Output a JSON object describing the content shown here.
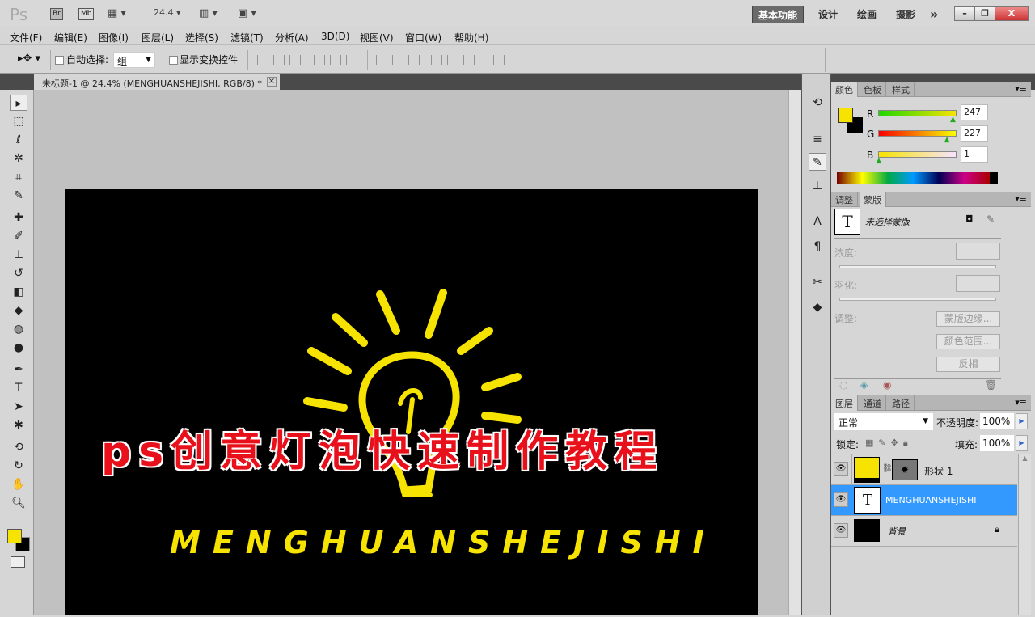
{
  "titlebar": {
    "logo": "Ps",
    "br": "Br",
    "mb": "Mb",
    "zoom": "24.4",
    "workspaces": [
      "基本功能",
      "设计",
      "绘画",
      "摄影"
    ],
    "more": "»",
    "min": "–",
    "restore": "❐",
    "close": "X"
  },
  "menu": [
    "文件(F)",
    "编辑(E)",
    "图像(I)",
    "图层(L)",
    "选择(S)",
    "滤镜(T)",
    "分析(A)",
    "3D(D)",
    "视图(V)",
    "窗口(W)",
    "帮助(H)"
  ],
  "options": {
    "auto_select_label": "自动选择:",
    "auto_select_value": "组",
    "show_transform_label": "显示变换控件"
  },
  "document": {
    "tab_title": "未标题-1 @ 24.4% (MENGHUANSHEJISHI, RGB/8) *",
    "close": "×"
  },
  "canvas": {
    "headline": "ps创意灯泡快速制作教程",
    "subtitle": "MENGHUANSHEJISHI"
  },
  "colors": {
    "foreground": "#f7e301",
    "background": "#000000",
    "accent": "#3399ff"
  },
  "color_panel": {
    "tabs": [
      "颜色",
      "色板",
      "样式"
    ],
    "r_label": "R",
    "g_label": "G",
    "b_label": "B",
    "r": "247",
    "g": "227",
    "b": "1",
    "r_value": 247,
    "g_value": 227,
    "b_value": 1
  },
  "mask_panel": {
    "tabs": [
      "调整",
      "蒙版"
    ],
    "status": "未选择蒙版",
    "density_label": "浓度:",
    "feather_label": "羽化:",
    "adjust_label": "调整:",
    "buttons": [
      "蒙版边缘...",
      "颜色范围...",
      "反相"
    ]
  },
  "layers_panel": {
    "tabs": [
      "图层",
      "通道",
      "路径"
    ],
    "blend_mode": "正常",
    "opacity_label": "不透明度:",
    "opacity": "100%",
    "lock_label": "锁定:",
    "fill_label": "填充:",
    "fill": "100%",
    "layers": [
      {
        "name": "形状 1",
        "selected": false
      },
      {
        "name": "MENGHUANSHEJISHI",
        "selected": true
      },
      {
        "name": "背景",
        "selected": false
      }
    ]
  }
}
